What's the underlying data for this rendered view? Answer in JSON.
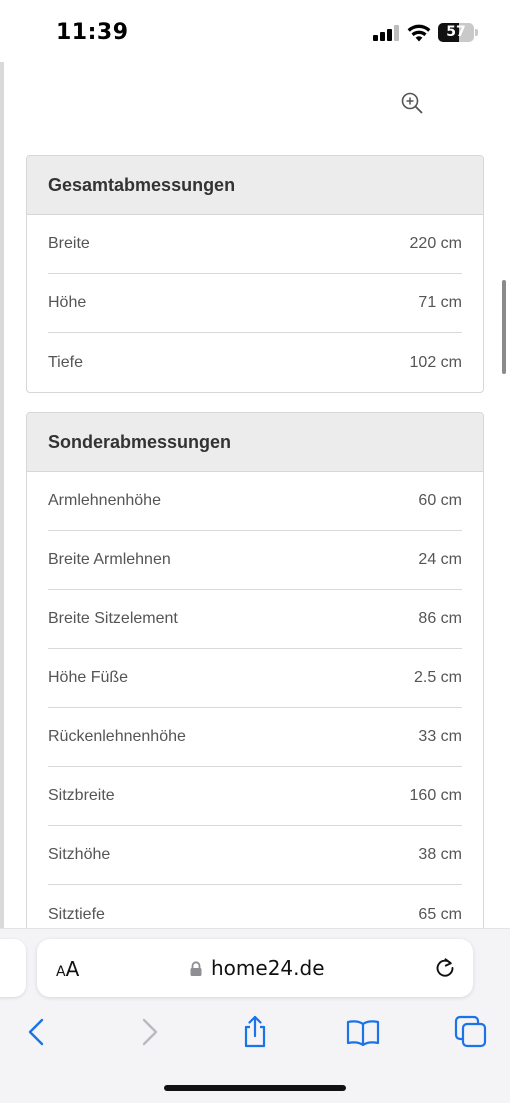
{
  "status_bar": {
    "time": "11:39",
    "battery": "57"
  },
  "icons": {
    "zoom": "zoom-in-icon",
    "back": "chevron-left-icon",
    "forward": "chevron-right-icon",
    "share": "share-icon",
    "bookmarks": "book-icon",
    "tabs": "tabs-icon",
    "reload": "reload-icon",
    "lock": "lock-icon"
  },
  "gesamt": {
    "title": "Gesamtabmessungen",
    "rows": [
      {
        "label": "Breite",
        "value": "220 cm"
      },
      {
        "label": "Höhe",
        "value": "71 cm"
      },
      {
        "label": "Tiefe",
        "value": "102 cm"
      }
    ]
  },
  "sonder": {
    "title": "Sonderabmessungen",
    "rows": [
      {
        "label": "Armlehnenhöhe",
        "value": "60 cm"
      },
      {
        "label": "Breite Armlehnen",
        "value": "24 cm"
      },
      {
        "label": "Breite Sitzelement",
        "value": "86 cm"
      },
      {
        "label": "Höhe Füße",
        "value": "2.5 cm"
      },
      {
        "label": "Rückenlehnenhöhe",
        "value": "33 cm"
      },
      {
        "label": "Sitzbreite",
        "value": "160 cm"
      },
      {
        "label": "Sitzhöhe",
        "value": "38 cm"
      },
      {
        "label": "Sitztiefe",
        "value": "65 cm"
      }
    ]
  },
  "browser": {
    "text_size_big": "A",
    "text_size_small": "A",
    "domain": "home24.de"
  },
  "colors": {
    "toolbar_accent": "#1a73e8",
    "toolbar_disabled": "#b9b9bf",
    "card_header_bg": "#ececec"
  }
}
